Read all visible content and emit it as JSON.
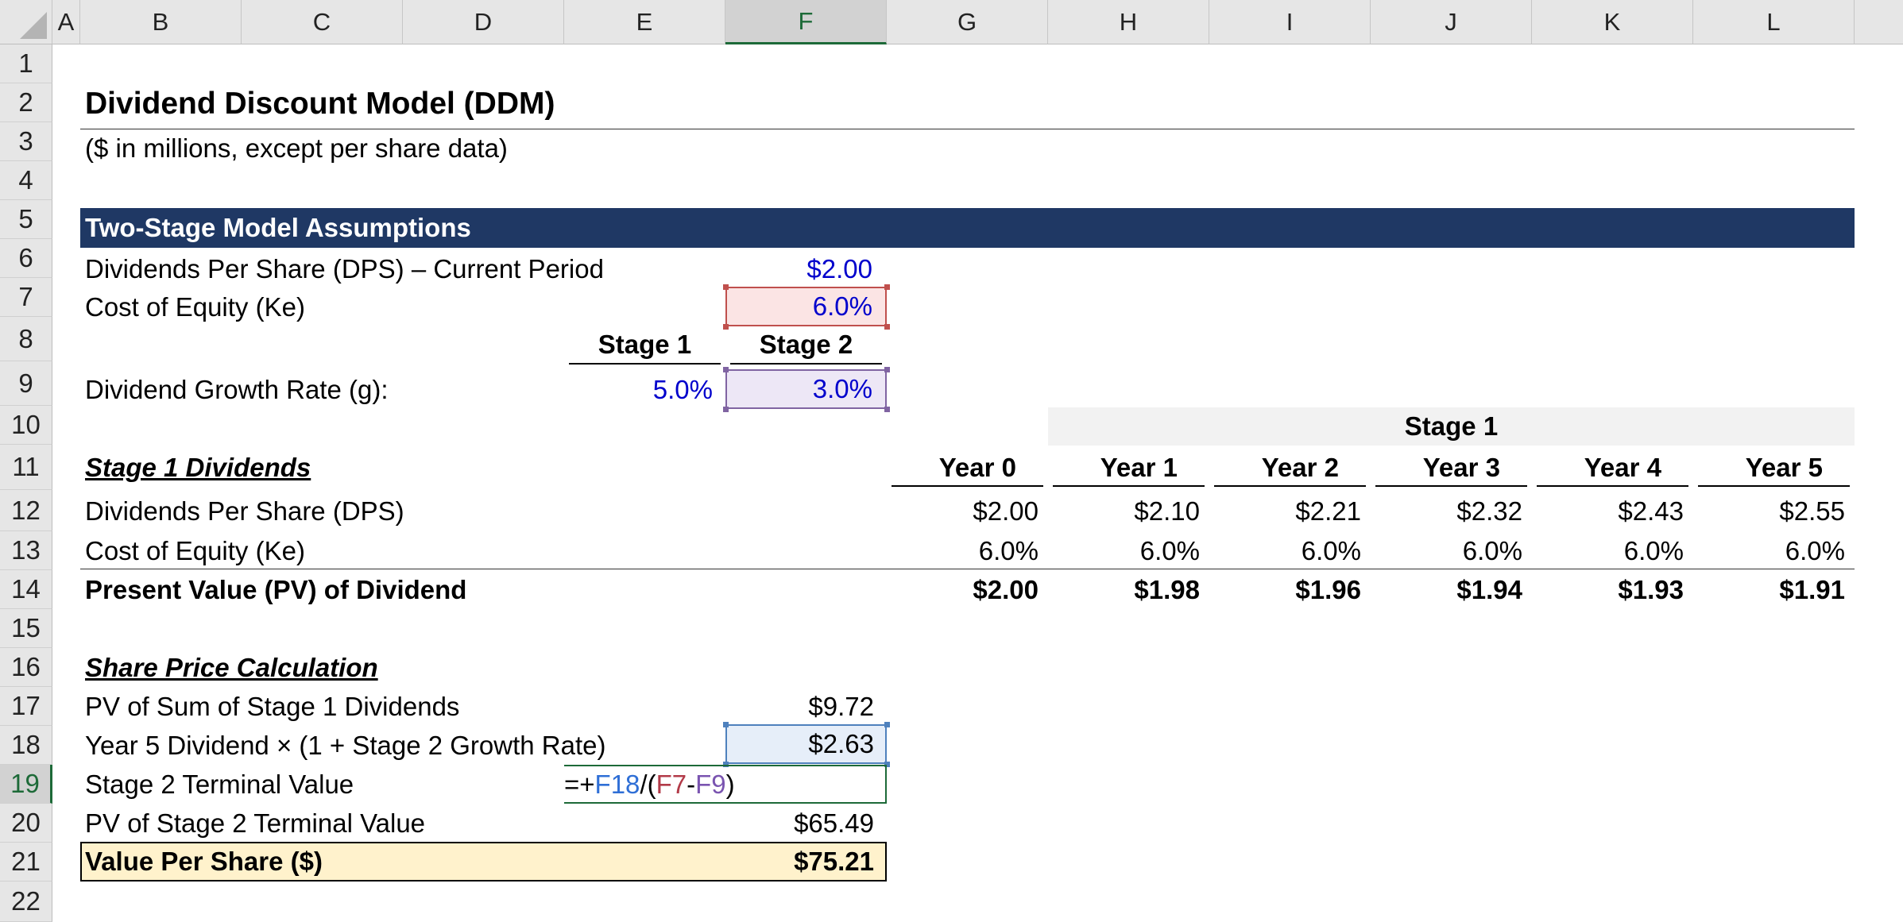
{
  "columns": [
    "A",
    "B",
    "C",
    "D",
    "E",
    "F",
    "G",
    "H",
    "I",
    "J",
    "K",
    "L"
  ],
  "rows": [
    "1",
    "2",
    "3",
    "4",
    "5",
    "6",
    "7",
    "8",
    "9",
    "10",
    "11",
    "12",
    "13",
    "14",
    "15",
    "16",
    "17",
    "18",
    "19",
    "20",
    "21",
    "22"
  ],
  "selected_column": "F",
  "selected_row": "19",
  "title": "Dividend Discount Model (DDM)",
  "subtitle": "($ in millions, except per share data)",
  "assumptions": {
    "header": "Two-Stage Model Assumptions",
    "dps_label": "Dividends Per Share (DPS) – Current Period",
    "dps_value": "$2.00",
    "ke_label": "Cost of Equity (Ke)",
    "ke_value": "6.0%",
    "stage1_header": "Stage 1",
    "stage2_header": "Stage 2",
    "growth_label": "Dividend Growth Rate (g):",
    "growth_stage1": "5.0%",
    "growth_stage2": "3.0%"
  },
  "stage1": {
    "section_label": "Stage 1 Dividends",
    "group_header": "Stage 1",
    "years": [
      "Year 0",
      "Year 1",
      "Year 2",
      "Year 3",
      "Year 4",
      "Year 5"
    ],
    "dps_label": "Dividends Per Share (DPS)",
    "dps": [
      "$2.00",
      "$2.10",
      "$2.21",
      "$2.32",
      "$2.43",
      "$2.55"
    ],
    "ke_label": "Cost of Equity (Ke)",
    "ke": [
      "6.0%",
      "6.0%",
      "6.0%",
      "6.0%",
      "6.0%",
      "6.0%"
    ],
    "pv_label": "Present Value (PV) of Dividend",
    "pv": [
      "$2.00",
      "$1.98",
      "$1.96",
      "$1.94",
      "$1.93",
      "$1.91"
    ]
  },
  "share_price": {
    "section_label": "Share Price Calculation",
    "pv_sum_label": "PV of Sum of Stage 1 Dividends",
    "pv_sum_value": "$9.72",
    "y5_label": "Year 5 Dividend × (1 + Stage 2 Growth Rate)",
    "y5_value": "$2.63",
    "tv_label": "Stage 2 Terminal Value",
    "formula": {
      "prefix": "=+",
      "ref1": "F18",
      "op1": "/(",
      "ref2": "F7",
      "op2": "-",
      "ref3": "F9",
      "suffix": ")"
    },
    "pv_tv_label": "PV of Stage 2 Terminal Value",
    "pv_tv_value": "$65.49",
    "vps_label": "Value Per Share ($)",
    "vps_value": "$75.21"
  },
  "colors": {
    "banner": "#1f3864",
    "input_blue": "#0000cc",
    "highlight_yellow": "#fff2cc",
    "ref_red_bg": "#fbe4e4",
    "ref_purple_bg": "#ede7f6",
    "ref_blue_bg": "#e6eef9",
    "selection_green": "#1d6a38"
  }
}
